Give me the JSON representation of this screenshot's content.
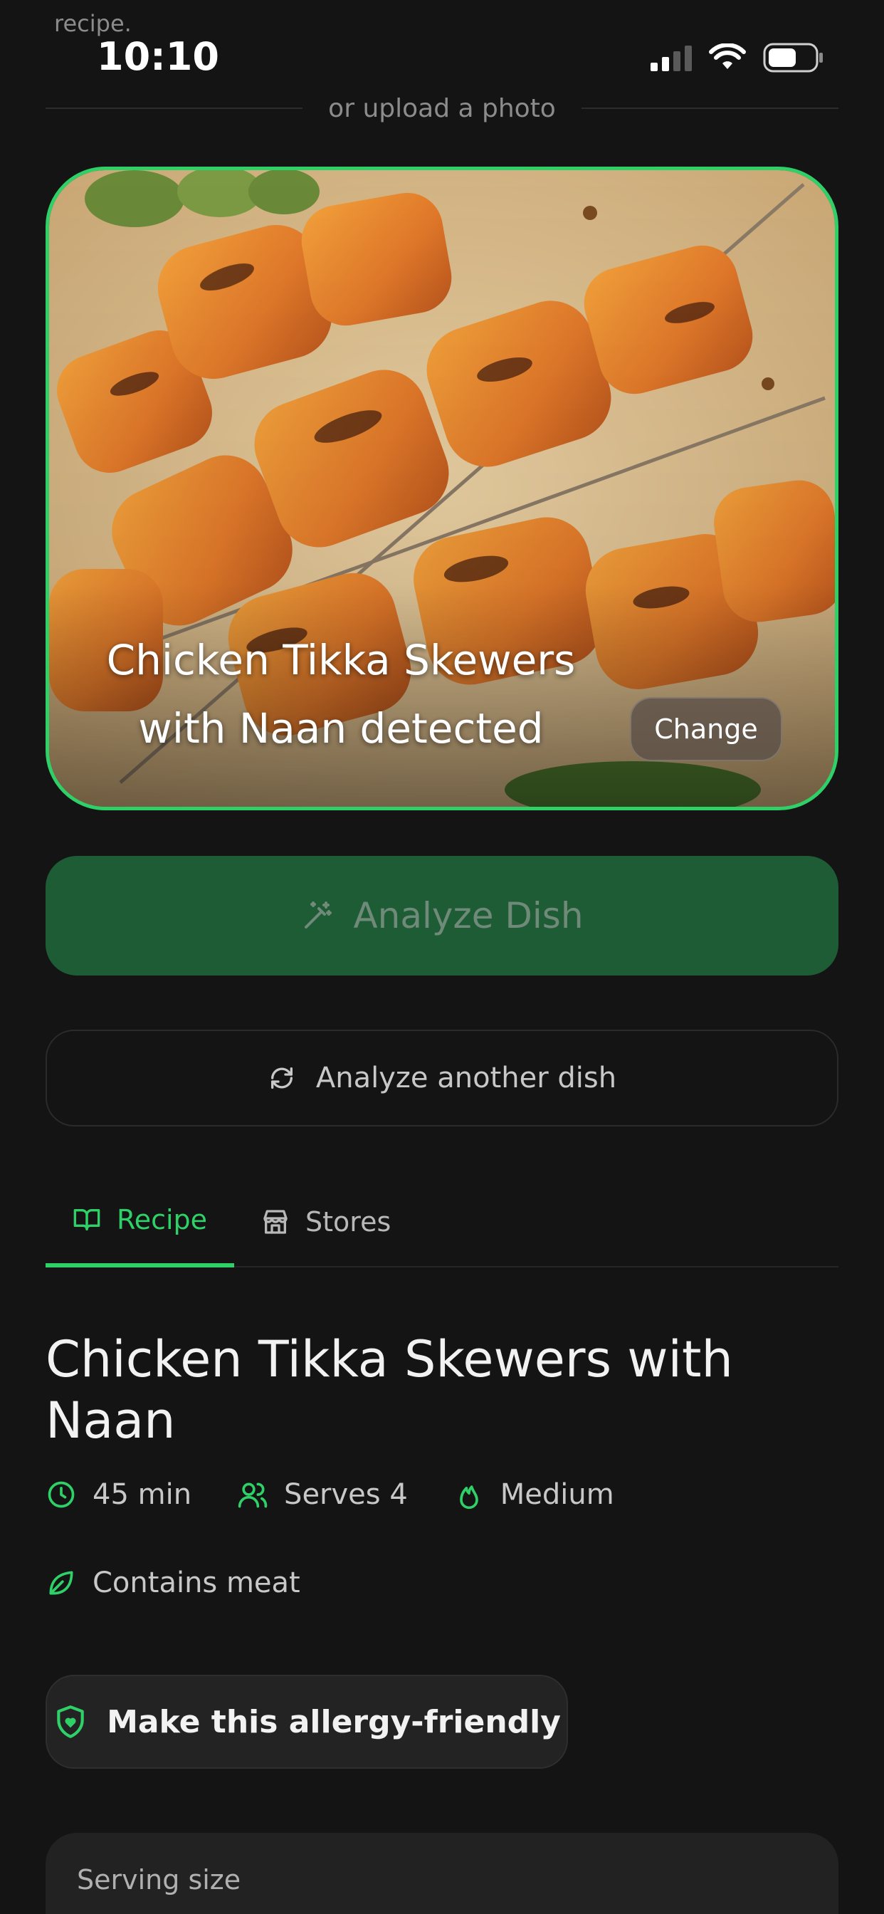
{
  "status_bar": {
    "truncated_text": "recipe.",
    "time": "10:10"
  },
  "upload": {
    "divider_text": "or upload a photo"
  },
  "photo": {
    "detected_line1": "Chicken Tikka Skewers",
    "detected_line2": "with Naan detected",
    "change_label": "Change",
    "border_color": "#2fd067"
  },
  "actions": {
    "analyze_label": "Analyze Dish",
    "analyze_icon": "magic-wand-icon",
    "another_label": "Analyze another dish",
    "another_icon": "refresh-icon"
  },
  "tabs": [
    {
      "label": "Recipe",
      "icon": "book-icon",
      "active": true
    },
    {
      "label": "Stores",
      "icon": "store-icon",
      "active": false
    }
  ],
  "recipe": {
    "title": "Chicken Tikka Skewers with Naan",
    "time": "45 min",
    "serves": "Serves 4",
    "difficulty": "Medium",
    "diet": "Contains meat",
    "allergy_button": "Make this allergy-friendly",
    "serving_size_label": "Serving size"
  },
  "colors": {
    "accent": "#2fd067",
    "background": "#141414",
    "analyze_bg": "#1e5c36"
  }
}
